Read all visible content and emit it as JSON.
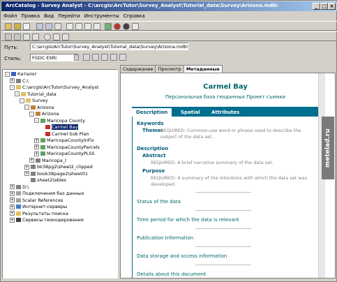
{
  "title": "ArcCatalog - Survey Analyst - C:\\arcgis\\ArcTutor\\Survey_Analyst\\Tutorial_data\\Survey\\Arizona.mdb\\Arizona\\Maricopa County\\Carmel Bay",
  "window_buttons": [
    "_",
    "□",
    "×"
  ],
  "menu": [
    "Файл",
    "Правка",
    "Вид",
    "Перейти",
    "Инструменты",
    "Справка"
  ],
  "path_label": "Путь:",
  "path_value": "C:\\arcgis\\ArcTutor\\Survey_Analyst\\Tutorial_data\\Survey\\Arizona.mdb\\Arizona\\Marico",
  "style_label": "Стиль:",
  "style_value": "FGDC ESRI",
  "tree": [
    {
      "label": "Каталог",
      "indent": 0,
      "pm": "-",
      "selected": false
    },
    {
      "label": "C:\\",
      "indent": 1,
      "pm": "+",
      "selected": false
    },
    {
      "label": "C:\\arcgis\\ArcTutor\\Survey_Analyst",
      "indent": 1,
      "pm": "-",
      "selected": false
    },
    {
      "label": "Tutorial_data",
      "indent": 2,
      "pm": "-",
      "selected": false
    },
    {
      "label": "Survey",
      "indent": 3,
      "pm": "-",
      "selected": false
    },
    {
      "label": "Arizona",
      "indent": 4,
      "pm": "-",
      "selected": false
    },
    {
      "label": "Arizona",
      "indent": 5,
      "pm": "-",
      "selected": false
    },
    {
      "label": "Maricopa County",
      "indent": 6,
      "pm": "-",
      "selected": false
    },
    {
      "label": "Carmel Bay",
      "indent": 7,
      "pm": "",
      "selected": true
    },
    {
      "label": "Carmel Sub Plan",
      "indent": 7,
      "pm": "",
      "selected": false
    },
    {
      "label": "MaricopaCountyInFix",
      "indent": 6,
      "pm": "+",
      "selected": false
    },
    {
      "label": "MaricopaCountyParcels",
      "indent": 6,
      "pm": "+",
      "selected": false
    },
    {
      "label": "MaricopaCountyPLSS",
      "indent": 6,
      "pm": "+",
      "selected": false
    },
    {
      "label": "Maricopa_I",
      "indent": 5,
      "pm": "+",
      "selected": false
    },
    {
      "label": "bk38pg2\\sheet2_clipped",
      "indent": 4,
      "pm": "+",
      "selected": false
    },
    {
      "label": "book38page2\\sheet01",
      "indent": 4,
      "pm": "+",
      "selected": false
    },
    {
      "label": "sheet2tables",
      "indent": 4,
      "pm": "",
      "selected": false
    },
    {
      "label": "D:\\",
      "indent": 1,
      "pm": "+",
      "selected": false
    },
    {
      "label": "Подключения баз данных",
      "indent": 1,
      "pm": "+",
      "selected": false
    },
    {
      "label": "Scalar References",
      "indent": 1,
      "pm": "+",
      "selected": false
    },
    {
      "label": "Интернет-серверы",
      "indent": 1,
      "pm": "+",
      "selected": false
    },
    {
      "label": "Результаты поиска",
      "indent": 1,
      "pm": "+",
      "selected": false
    },
    {
      "label": "Сервисы геокодирования",
      "indent": 1,
      "pm": "+",
      "selected": false
    }
  ],
  "tabs": [
    "Содержание",
    "Просмотр",
    "Метаданные"
  ],
  "content": {
    "title": "Carmel Bay",
    "subtitle": "Персональная база геоданных Проект съемки",
    "tabs": [
      "Description",
      "Spatial",
      "Attributes"
    ],
    "keywords_heading": "Keywords",
    "theme_label": "Theme:",
    "theme_text": "REQUIRED: Common-use word or phrase used to describe the subject of the data set.",
    "description_heading": "Description",
    "abstract_heading": "Abstract",
    "abstract_text": "REQUIRED: A brief narrative summary of the data set.",
    "purpose_heading": "Purpose",
    "purpose_text": "REQUIRED: A summary of the intentions with which the data set was developed.",
    "sections": [
      "Status of the data",
      "Time period for which the data is relevant",
      "Publication Information",
      "Data storage and access information",
      "Details about this document"
    ]
  },
  "watermark": "metelad.ru"
}
